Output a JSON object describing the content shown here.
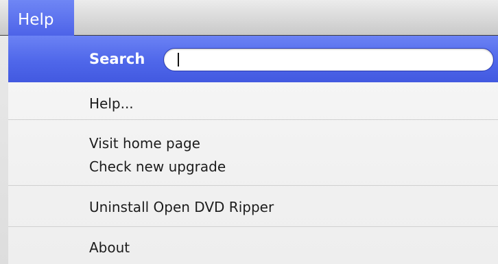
{
  "menubar": {
    "title": "Help"
  },
  "menu": {
    "search": {
      "label": "Search",
      "value": ""
    },
    "items": [
      {
        "label": "Help..."
      },
      {
        "label": "Visit home page"
      },
      {
        "label": "Check new upgrade"
      },
      {
        "label": "Uninstall Open DVD Ripper"
      },
      {
        "label": "About"
      }
    ]
  },
  "colors": {
    "highlight": "#4f67ea",
    "menu_background": "#f4f4f4"
  }
}
